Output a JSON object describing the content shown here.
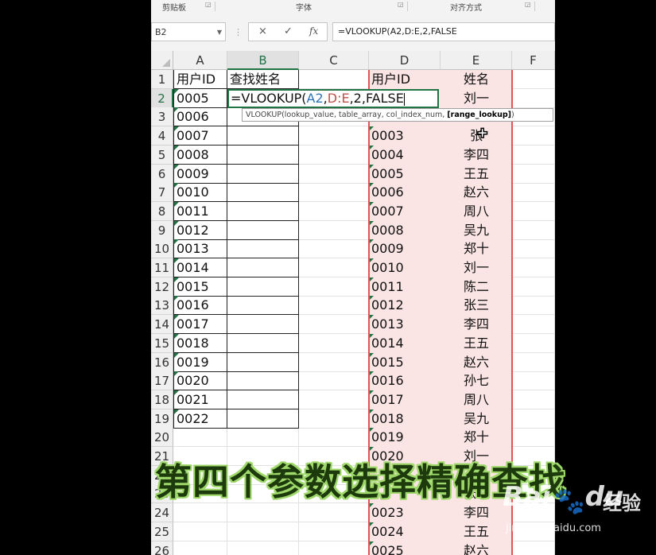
{
  "ribbon": {
    "groups": [
      "剪贴板",
      "字体",
      "对齐方式"
    ]
  },
  "name_box": {
    "value": "B2"
  },
  "formula_bar": {
    "cancel_icon": "×",
    "enter_icon": "✓",
    "fx_label": "fx",
    "value": "=VLOOKUP(A2,D:E,2,FALSE"
  },
  "columns": [
    "A",
    "B",
    "C",
    "D",
    "E",
    "F"
  ],
  "rows": [
    "1",
    "2",
    "3",
    "4",
    "5",
    "6",
    "7",
    "8",
    "9",
    "10",
    "11",
    "12",
    "13",
    "14",
    "15",
    "16",
    "17",
    "18",
    "19",
    "20",
    "21",
    "22",
    "23",
    "24",
    "25",
    "26"
  ],
  "col_a": [
    "用户ID",
    "0005",
    "0006",
    "0007",
    "0008",
    "0009",
    "0010",
    "0011",
    "0012",
    "0013",
    "0014",
    "0015",
    "0016",
    "0017",
    "0018",
    "0019",
    "0020",
    "0021",
    "0022"
  ],
  "col_b_header": "查找姓名",
  "col_d": [
    "用户ID",
    "",
    "",
    "0003",
    "0004",
    "0005",
    "0006",
    "0007",
    "0008",
    "0009",
    "0010",
    "0011",
    "0012",
    "0013",
    "0014",
    "0015",
    "0016",
    "0017",
    "0018",
    "0019",
    "0020",
    "",
    "",
    "0023",
    "0024",
    "0025"
  ],
  "col_e": [
    "姓名",
    "刘一",
    "",
    "张",
    "李四",
    "王五",
    "赵六",
    "周八",
    "吴九",
    "郑十",
    "刘一",
    "陈二",
    "张三",
    "李四",
    "王五",
    "赵六",
    "孙七",
    "周八",
    "吴九",
    "郑十",
    "刘一",
    "",
    "张三",
    "李四",
    "王五",
    "赵六"
  ],
  "edit_cell": {
    "formula_start": "=VLOOKUP(",
    "ref1": "A2",
    "comma1": ",",
    "ref2": "D:E",
    "rest": ",2,FALSE"
  },
  "tooltip": {
    "text": "VLOOKUP(lookup_value, table_array, col_index_num, ",
    "bold": "[range_lookup]",
    "end": ")"
  },
  "subtitle": "第四个参数选择精确查找",
  "watermark": {
    "brand": "Bai",
    "brand2": "du",
    "suffix": "经验",
    "url": "jingyan.baidu.com"
  },
  "colors": {
    "accent": "#217346",
    "ref1": "#2e75b6",
    "ref2": "#c0504d",
    "table_fill": "#fae4e4"
  }
}
